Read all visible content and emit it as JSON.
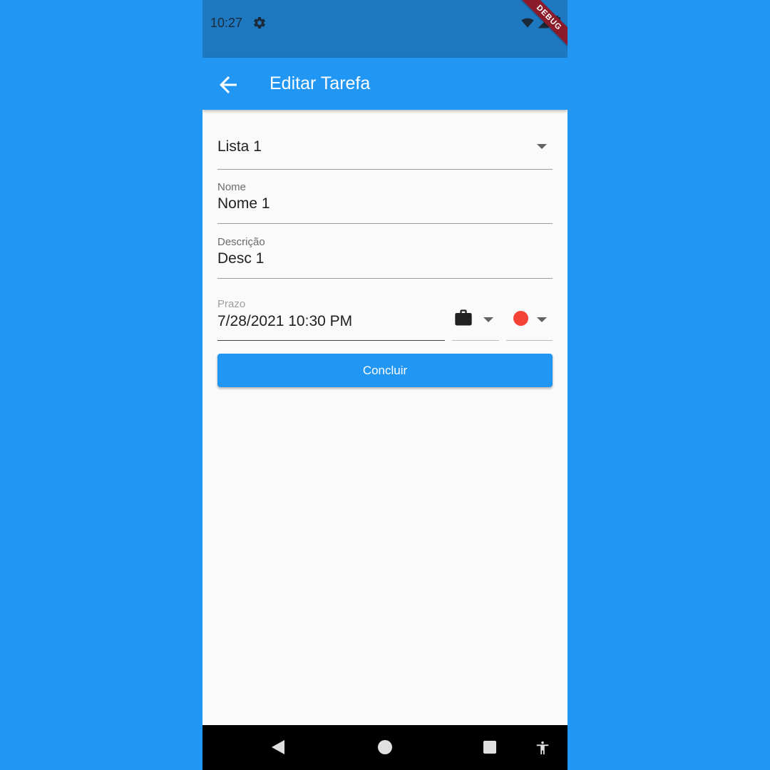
{
  "status_bar": {
    "time": "10:27",
    "debug_banner": "DEBUG"
  },
  "app_bar": {
    "title": "Editar Tarefa"
  },
  "form": {
    "list_dropdown": {
      "value": "Lista 1"
    },
    "nome": {
      "label": "Nome",
      "value": "Nome 1"
    },
    "descricao": {
      "label": "Descrição",
      "value": "Desc 1"
    },
    "prazo": {
      "label": "Prazo",
      "value": "7/28/2021 10:30 PM"
    },
    "icon_dropdown": {
      "icon": "briefcase-icon"
    },
    "color_dropdown": {
      "color": "#F44336"
    },
    "submit_label": "Concluir"
  },
  "colors": {
    "primary": "#2196F3",
    "status_bar": "#1E78C0",
    "background": "#FAFAFA"
  }
}
